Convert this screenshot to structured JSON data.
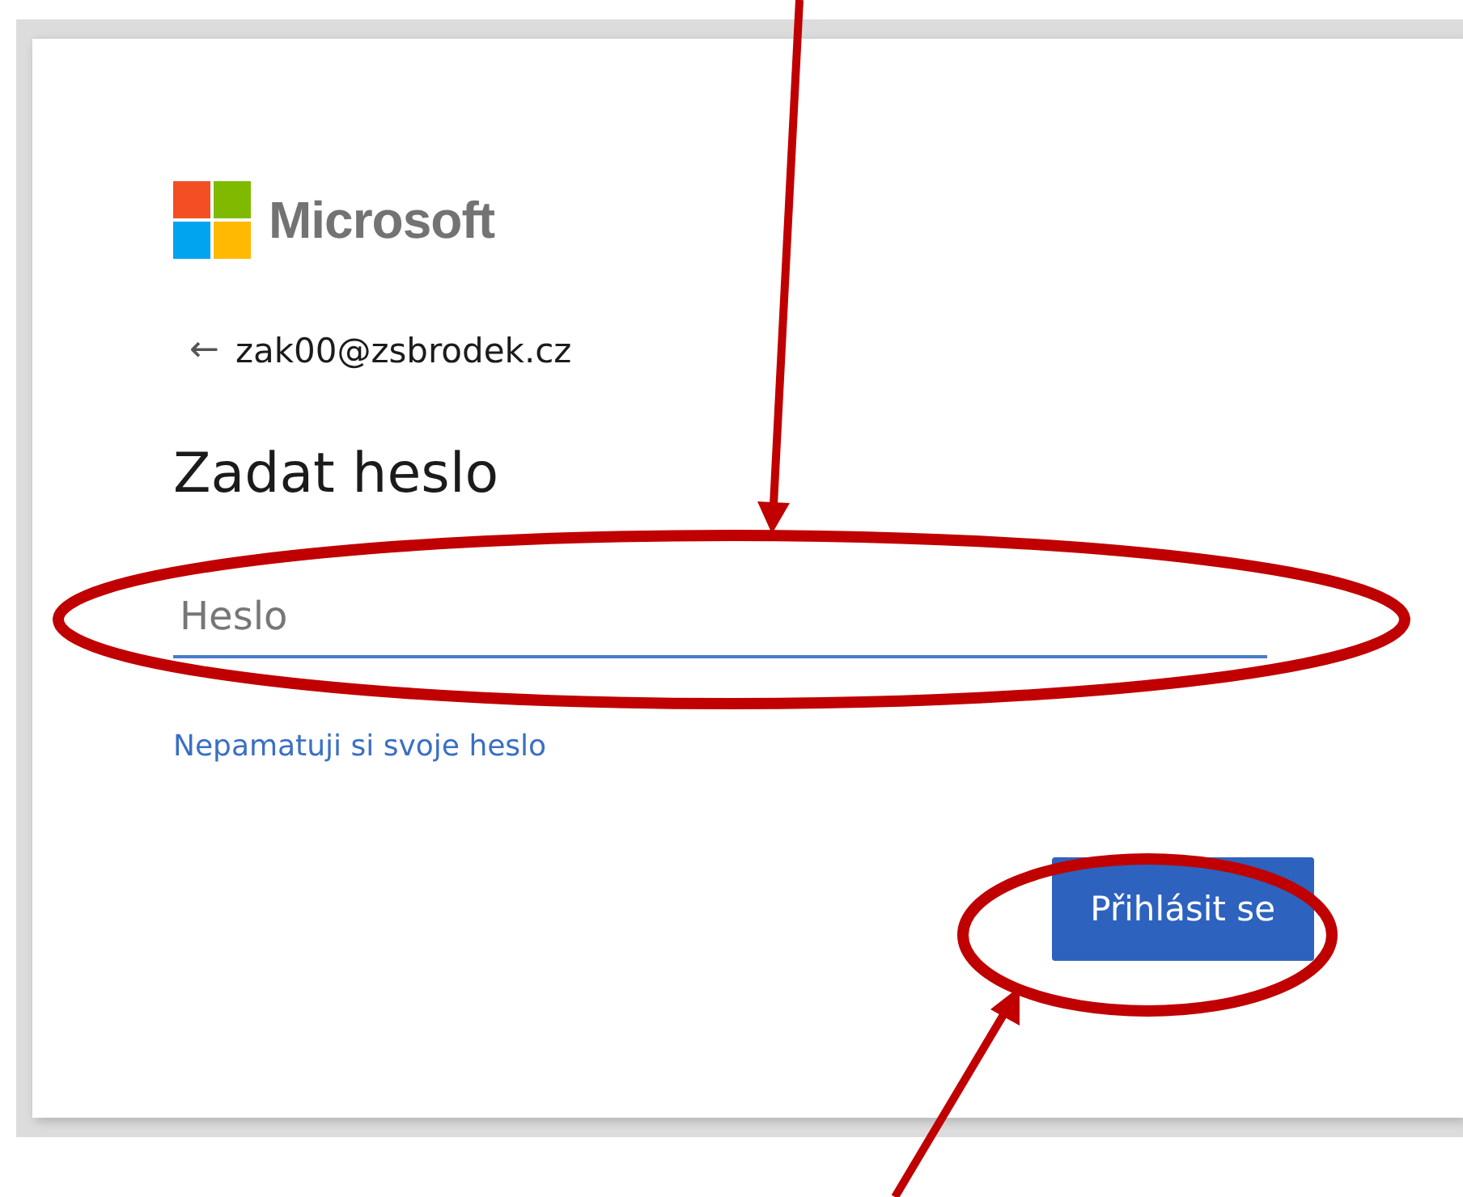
{
  "logo": {
    "text": "Microsoft"
  },
  "account": {
    "back": "←",
    "email": "zak00@zsbrodek.cz"
  },
  "heading": "Zadat heslo",
  "password": {
    "placeholder": "Heslo"
  },
  "forgot_link": "Nepamatuji si svoje heslo",
  "buttons": [
    "Přihlásit se"
  ]
}
